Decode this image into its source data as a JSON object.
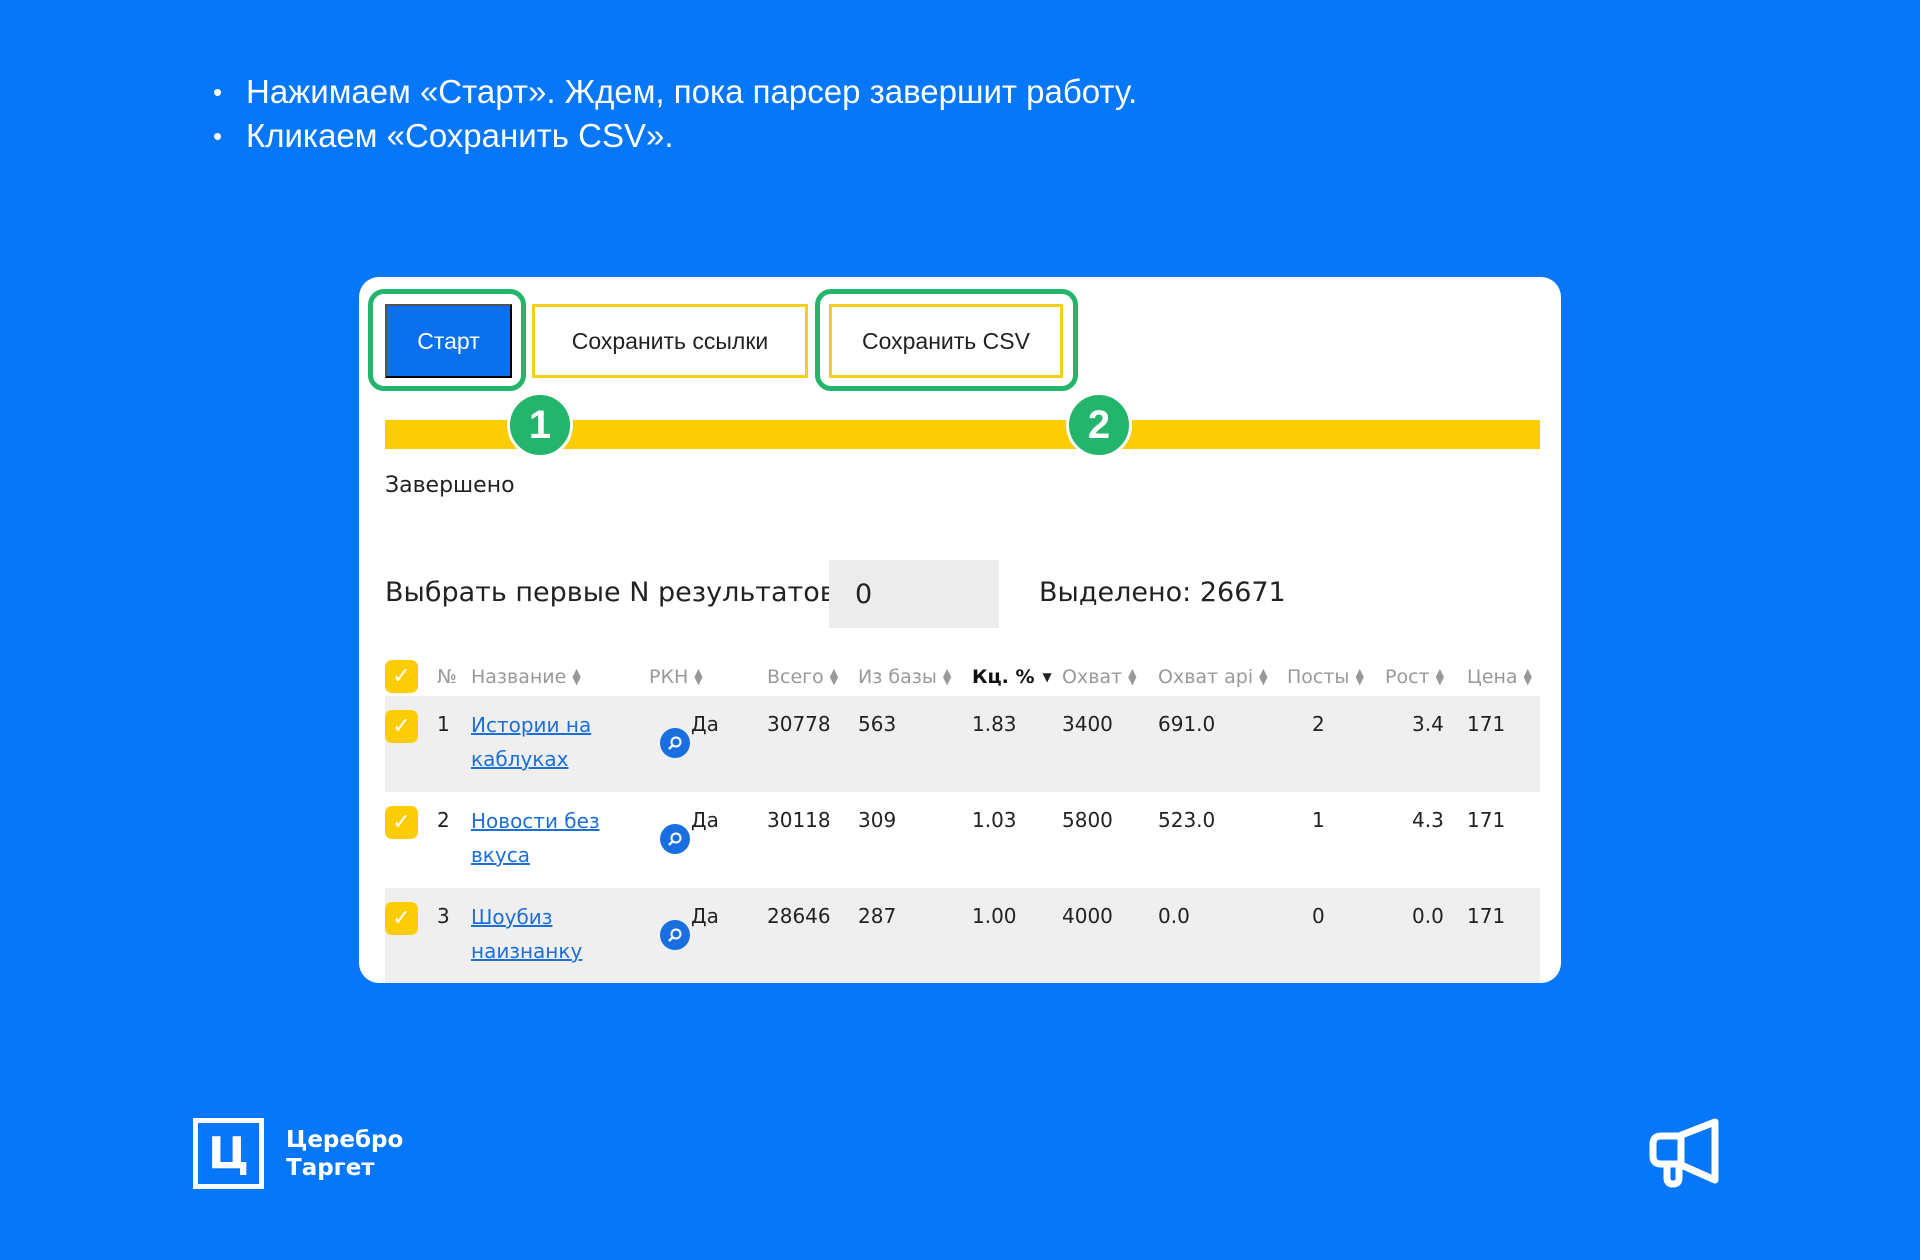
{
  "bullets": [
    "Нажимаем «Старт». Ждем, пока парсер завершит работу.",
    "Кликаем «Сохранить CSV»."
  ],
  "toolbar": {
    "start_label": "Старт",
    "save_links_label": "Сохранить ссылки",
    "save_csv_label": "Сохранить CSV"
  },
  "badges": [
    "1",
    "2"
  ],
  "progress": {
    "fraction": 1.0,
    "color": "#fccd05"
  },
  "status": "Завершено",
  "select": {
    "label": "Выбрать первые N результатов:",
    "value": "0",
    "selected_text": "Выделено: 26671"
  },
  "table": {
    "columns": [
      "№",
      "Название",
      "РКН",
      "Всего",
      "Из базы",
      "Кц. %",
      "Охват",
      "Охват api",
      "Посты",
      "Рост",
      "Цена"
    ],
    "sorted_column": "Кц. %",
    "rows": [
      [
        "1",
        "Истории на каблуках",
        "Да",
        "30778",
        "563",
        "1.83",
        "3400",
        "691.0",
        "2",
        "3.4",
        "171"
      ],
      [
        "2",
        "Новости без вкуса",
        "Да",
        "30118",
        "309",
        "1.03",
        "5800",
        "523.0",
        "1",
        "4.3",
        "171"
      ],
      [
        "3",
        "Шоубиз наизнанку",
        "Да",
        "28646",
        "287",
        "1.00",
        "4000",
        "0.0",
        "0",
        "0.0",
        "171"
      ]
    ]
  },
  "logo": {
    "letter": "Ц",
    "line1": "Церебро",
    "line2": "Таргет"
  },
  "colors": {
    "background": "#0577f8",
    "accent_green": "#23b56b",
    "accent_yellow": "#fccd05",
    "button_blue": "#0a70ee"
  },
  "icons": {
    "row_action": "search-icon",
    "corner": "megaphone-icon"
  }
}
